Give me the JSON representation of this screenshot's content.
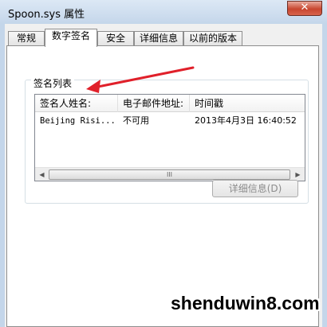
{
  "window": {
    "title": "Spoon.sys 属性",
    "close_label": "✕"
  },
  "tabs": [
    {
      "label": "常规"
    },
    {
      "label": "数字签名"
    },
    {
      "label": "安全"
    },
    {
      "label": "详细信息"
    },
    {
      "label": "以前的版本"
    }
  ],
  "active_tab": "数字签名",
  "signature_list": {
    "group_label": "签名列表",
    "columns": [
      "签名人姓名:",
      "电子邮件地址:",
      "时间戳"
    ],
    "rows": [
      {
        "name": "Beijing Risi...",
        "email": "不可用",
        "timestamp": "2013年4月3日 16:40:52"
      }
    ],
    "scroll_thumb_glyph": "III",
    "scroll_left": "◀",
    "scroll_right": "▶"
  },
  "details_button": {
    "label": "详细信息(D)",
    "enabled": false
  },
  "annotation": {
    "color": "#e0202a"
  },
  "watermark": {
    "text": "shenduwin8.com"
  }
}
